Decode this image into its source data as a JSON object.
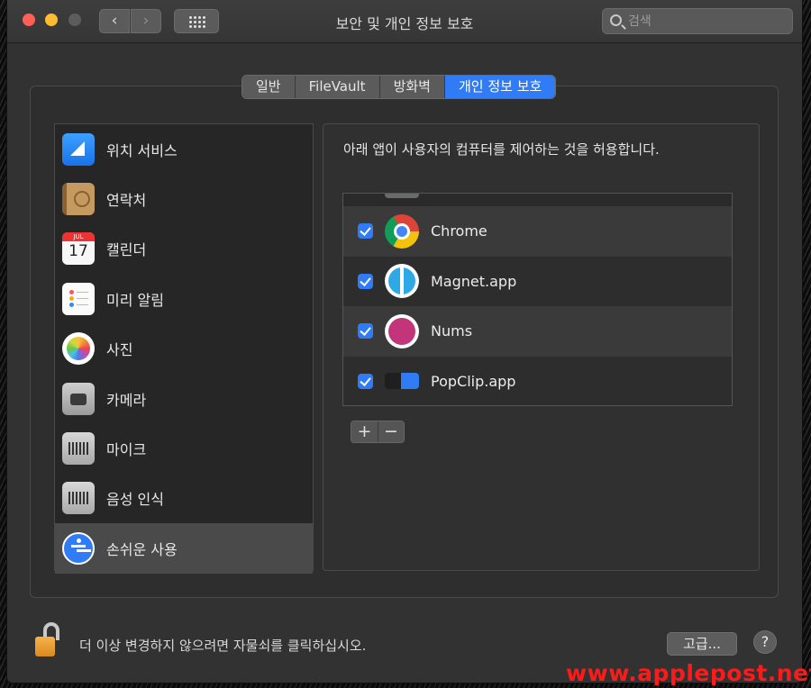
{
  "window": {
    "title": "보안 및 개인 정보 보호",
    "back_glyph": "‹",
    "forward_glyph": "›"
  },
  "search": {
    "placeholder": "검색",
    "value": ""
  },
  "tabs": [
    {
      "label": "일반",
      "active": false
    },
    {
      "label": "FileVault",
      "active": false
    },
    {
      "label": "방화벽",
      "active": false
    },
    {
      "label": "개인 정보 보호",
      "active": true
    }
  ],
  "categories": [
    {
      "label": "위치 서비스",
      "icon": "location-icon"
    },
    {
      "label": "연락처",
      "icon": "contacts-icon"
    },
    {
      "label": "캘린더",
      "icon": "calendar-icon",
      "month": "JUL",
      "day": "17"
    },
    {
      "label": "미리 알림",
      "icon": "reminders-icon"
    },
    {
      "label": "사진",
      "icon": "photos-icon"
    },
    {
      "label": "카메라",
      "icon": "camera-icon"
    },
    {
      "label": "마이크",
      "icon": "microphone-icon"
    },
    {
      "label": "음성 인식",
      "icon": "speech-recognition-icon"
    },
    {
      "label": "손쉬운 사용",
      "icon": "accessibility-icon",
      "selected": true
    }
  ],
  "panel": {
    "description": "아래 앱이 사용자의 컴퓨터를 제어하는 것을 허용합니다.",
    "apps": [
      {
        "name": "Chrome",
        "checked": true,
        "icon": "chrome-icon"
      },
      {
        "name": "Magnet.app",
        "checked": true,
        "icon": "magnet-icon"
      },
      {
        "name": "Nums",
        "checked": true,
        "icon": "nums-icon"
      },
      {
        "name": "PopClip.app",
        "checked": true,
        "icon": "popclip-icon"
      }
    ],
    "add_label": "+",
    "remove_label": "−"
  },
  "footer": {
    "lock_text": "더 이상 변경하지 않으려면 자물쇠를 클릭하십시오.",
    "advanced_label": "고급...",
    "help_label": "?"
  },
  "watermark": "www.applepost.net",
  "colors": {
    "accent": "#2f7cf6",
    "watermark": "#ff1a1a"
  }
}
